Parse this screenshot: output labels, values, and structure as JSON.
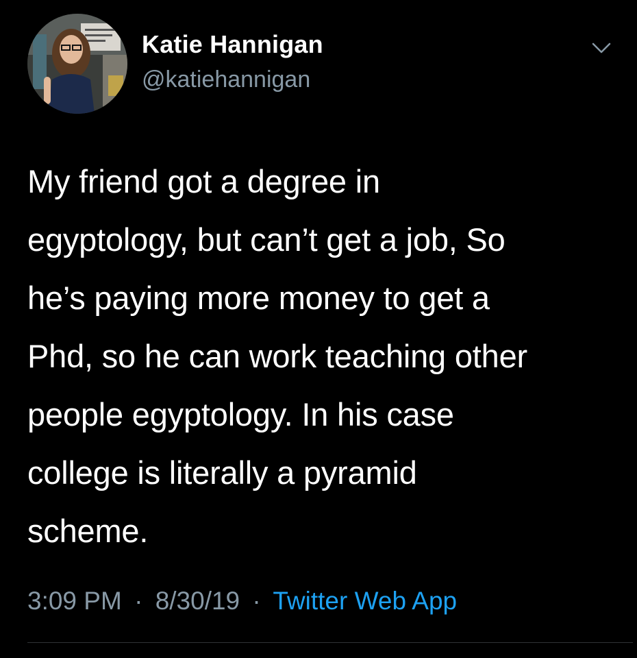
{
  "author": {
    "name": "Katie Hannigan",
    "handle": "@katiehannigan",
    "avatar_icon": "profile-photo"
  },
  "menu_icon": "chevron-down-icon",
  "tweet": {
    "lines": [
      "My friend got a degree in",
      "egyptology, but can’t get a job, So",
      "he’s paying more money to get a",
      "Phd, so he can work teaching other",
      "people egyptology.  In his case",
      "college is literally a pyramid",
      "scheme."
    ]
  },
  "meta": {
    "time": "3:09 PM",
    "separator": "·",
    "date": "8/30/19",
    "source": "Twitter Web App"
  },
  "colors": {
    "background": "#000000",
    "text": "#ffffff",
    "secondary": "#8899a6",
    "link": "#1da1f2",
    "divider": "#2f3336"
  }
}
